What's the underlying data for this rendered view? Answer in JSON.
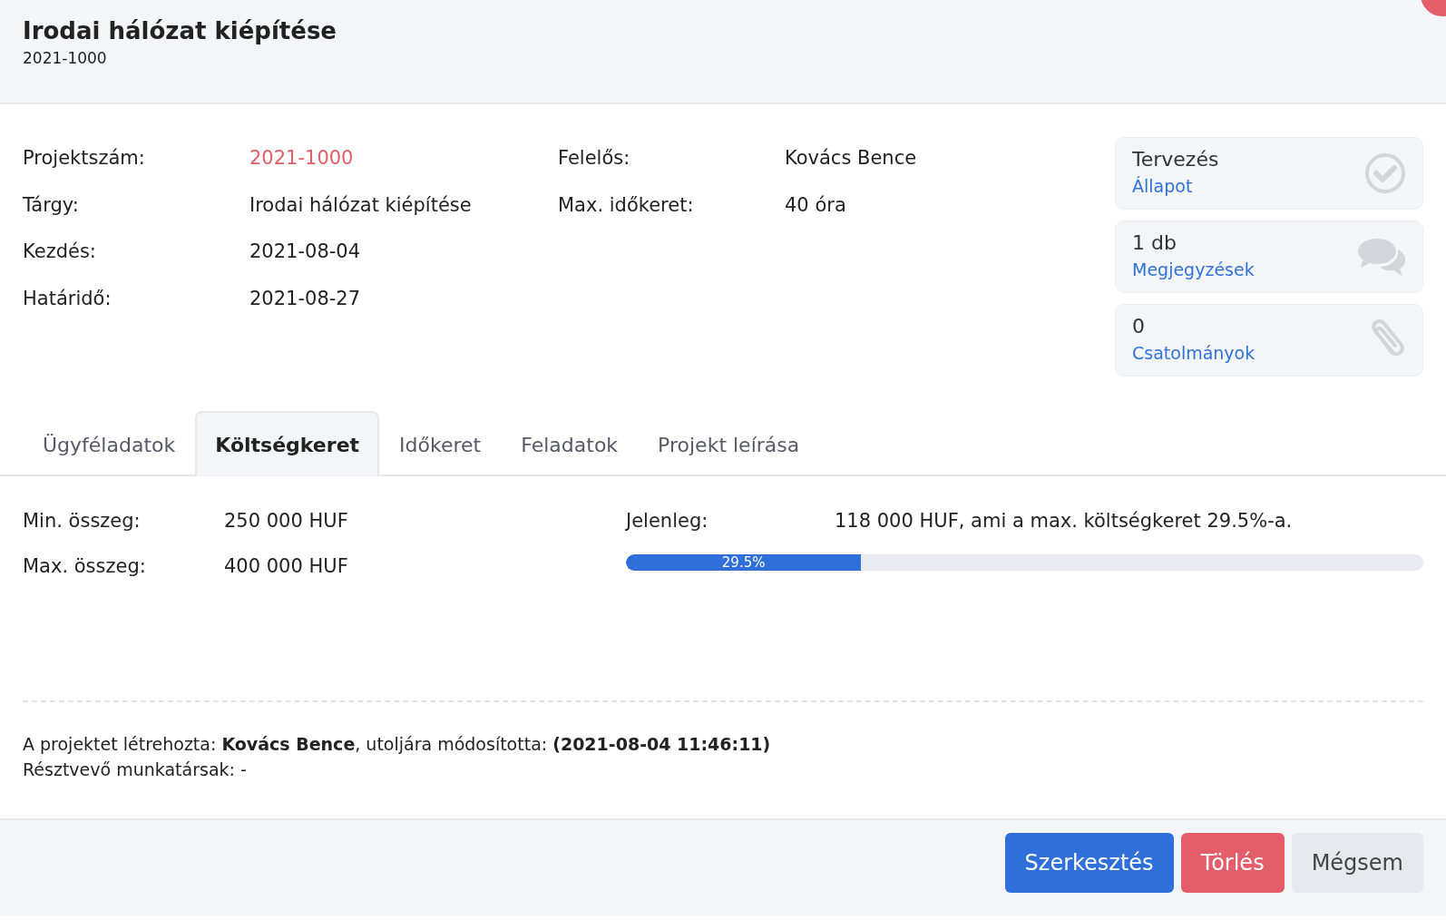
{
  "header": {
    "title": "Irodai hálózat kiépítése",
    "subtitle": "2021-1000"
  },
  "details": [
    {
      "label": "Projektszám:",
      "value": "2021-1000",
      "highlighted": true
    },
    {
      "label": "Tárgy:",
      "value": "Irodai hálózat kiépítése",
      "highlighted": false
    },
    {
      "label": "Kezdés:",
      "value": "2021-08-04",
      "highlighted": false
    },
    {
      "label": "Határidő:",
      "value": "2021-08-27",
      "highlighted": false
    }
  ],
  "details_2": [
    {
      "label": "Felelős:",
      "value": "Kovács Bence",
      "highlighted": false
    },
    {
      "label": "Max. időkeret:",
      "value": "40 óra",
      "highlighted": false
    }
  ],
  "stat_cards": [
    {
      "kind": "status",
      "value": "Tervezés",
      "label": "Állapot"
    },
    {
      "kind": "comments",
      "value": "1 db",
      "label": "Megjegyzések"
    },
    {
      "kind": "attachments",
      "value": "0",
      "label": "Csatolmányok"
    }
  ],
  "tabs": [
    {
      "label": "Ügyféladatok",
      "selected": false
    },
    {
      "label": "Költségkeret",
      "selected": true
    },
    {
      "label": "Időkeret",
      "selected": false
    },
    {
      "label": "Feladatok",
      "selected": false
    },
    {
      "label": "Projekt leírása",
      "selected": false
    }
  ],
  "budget": {
    "rows": [
      {
        "label": "Min. összeg:",
        "value": "250 000 HUF"
      },
      {
        "label": "Max. összeg:",
        "value": "400 000 HUF"
      }
    ],
    "current_label": "Jelenleg:",
    "current_value": "118 000 HUF, ami a max. költségkeret 29.5%-a.",
    "progress": {
      "level": 0.295,
      "reading": "29.5%"
    }
  },
  "footer": {
    "created": "A projektet létrehozta: **Kovács Bence**, utoljára módosította: **(2021-08-04 11:46:11)**",
    "participants": "Résztvevő munkatársak: -"
  },
  "buttons": [
    {
      "label": "Szerkesztés",
      "kind": "primary"
    },
    {
      "label": "Törlés",
      "kind": "danger"
    },
    {
      "label": "Mégsem",
      "kind": "secondary"
    }
  ]
}
